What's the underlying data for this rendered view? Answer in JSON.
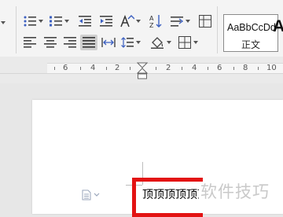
{
  "ribbon": {
    "style_gallery": {
      "sample": "AaBbCcDd",
      "style_name": "正文"
    },
    "style_gallery_next": {
      "sample": "A"
    }
  },
  "ruler": {
    "labels": [
      "6",
      "4",
      "2",
      "2",
      "4",
      "6",
      "8",
      "10"
    ]
  },
  "document": {
    "text": "顶顶顶顶顶顶",
    "watermark": "软件技巧"
  },
  "colors": {
    "highlight": "#e31313",
    "ribbon_bg": "#f4f4f4",
    "ruler_bg": "#eaeaea"
  }
}
